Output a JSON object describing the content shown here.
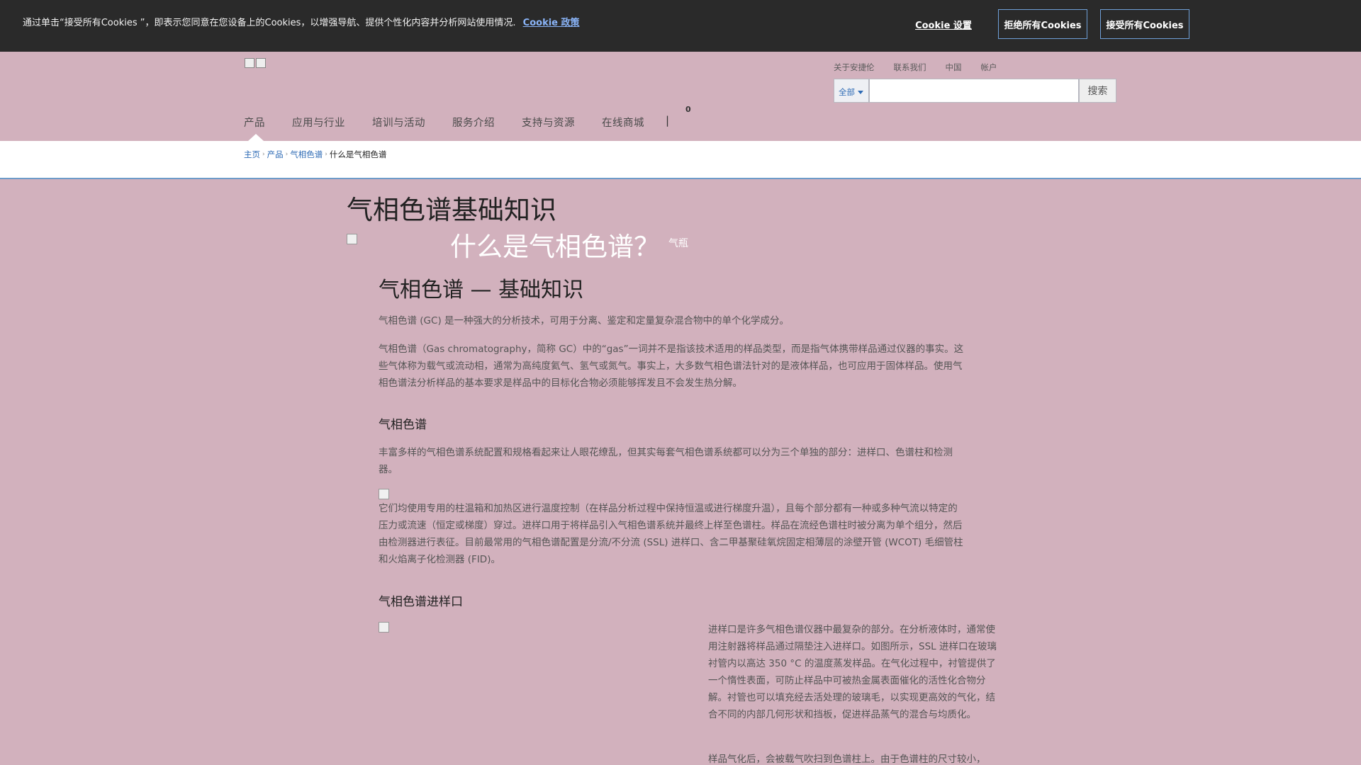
{
  "cookie": {
    "text": "通过单击“接受所有Cookies ”，即表示您同意在您设备上的Cookies，以增强导航、提供个性化内容并分析网站使用情况.",
    "policy_link": "Cookie 政策",
    "settings": "Cookie 设置",
    "reject": "拒绝所有Cookies",
    "accept": "接受所有Cookies"
  },
  "header": {
    "util_nav": [
      "关于安捷伦",
      "联系我们",
      "中国",
      "帐户"
    ],
    "search": {
      "scope": "全部",
      "button": "搜索",
      "placeholder": ""
    },
    "main_nav": [
      "产品",
      "应用与行业",
      "培训与活动",
      "服务介绍",
      "支持与资源",
      "在线商城"
    ],
    "pipe": "|",
    "cart_count": "0"
  },
  "breadcrumb": {
    "items": [
      "主页",
      "产品",
      "气相色谱"
    ],
    "current": "什么是气相色谱"
  },
  "content": {
    "title": "气相色谱基础知识",
    "subtitle": "什么是气相色谱？",
    "subtitle_img_alt": "气瓶",
    "h2": "气相色谱 — 基础知识",
    "p1": "气相色谱 (GC) 是一种强大的分析技术，可用于分离、鉴定和定量复杂混合物中的单个化学成分。",
    "p2": "气相色谱（Gas chromatography，简称 GC）中的“gas”一词并不是指该技术适用的样品类型，而是指气体携带样品通过仪器的事实。这些气体称为载气或流动相，通常为高纯度氦气、氢气或氮气。事实上，大多数气相色谱法针对的是液体样品，也可应用于固体样品。使用气相色谱法分析样品的基本要求是样品中的目标化合物必须能够挥发且不会发生热分解。",
    "h3_a": "气相色谱",
    "p3": "丰富多样的气相色谱系统配置和规格看起来让人眼花缭乱，但其实每套气相色谱系统都可以分为三个单独的部分：进样口、色谱柱和检测器。",
    "p4": "它们均使用专用的柱温箱和加热区进行温度控制（在样品分析过程中保持恒温或进行梯度升温），且每个部分都有一种或多种气流以特定的压力或流速（恒定或梯度）穿过。进样口用于将样品引入气相色谱系统并最终上样至色谱柱。样品在流经色谱柱时被分离为单个组分，然后由检测器进行表征。目前最常用的气相色谱配置是分流/不分流 (SSL) 进样口、含二甲基聚硅氧烷固定相薄层的涂壁开管 (WCOT) 毛细管柱和火焰离子化检测器 (FID)。",
    "h3_b": "气相色谱进样口",
    "p5": "进样口是许多气相色谱仪器中最复杂的部分。在分析液体时，通常使用注射器将样品通过隔垫注入进样口。如图所示，SSL 进样口在玻璃衬管内以高达 350 °C 的温度蒸发样品。在气化过程中，衬管提供了一个惰性表面，可防止样品中可被热金属表面催化的活性化合物分解。衬管也可以填充经去活处理的玻璃毛，以实现更高效的气化，结合不同的内部几何形状和挡板，促进样品蒸气的混合与均质化。",
    "p6": "样品气化后，会被载气吹扫到色谱柱上。由于色谱柱的尺寸较小，"
  }
}
